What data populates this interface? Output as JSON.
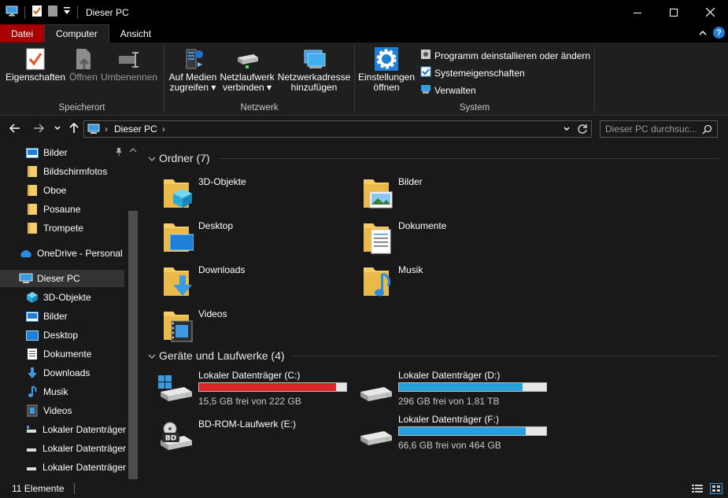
{
  "window": {
    "title": "Dieser PC",
    "controls": {
      "minimize": "—",
      "maximize": "☐",
      "close": "✕"
    }
  },
  "ribbon_tabs": [
    {
      "label": "Datei"
    },
    {
      "label": "Computer"
    },
    {
      "label": "Ansicht"
    }
  ],
  "ribbon": {
    "groups": {
      "speicherort": "Speicherort",
      "netzwerk": "Netzwerk",
      "system": "System"
    },
    "eigenschaften": "Eigenschaften",
    "oeffnen": "Öffnen",
    "umbenennen": "Umbenennen",
    "auf_medien": [
      "Auf Medien",
      "zugreifen ▾"
    ],
    "netzlaufwerk": [
      "Netzlaufwerk",
      "verbinden ▾"
    ],
    "netzwerkadresse": [
      "Netzwerkadresse",
      "hinzufügen"
    ],
    "einstellungen": [
      "Einstellungen",
      "öffnen"
    ],
    "programm_deinstallieren": "Programm deinstallieren oder ändern",
    "systemeigenschaften": "Systemeigenschaften",
    "verwalten": "Verwalten"
  },
  "address": {
    "path": "Dieser PC",
    "separator": "›",
    "search_placeholder": "Dieser PC durchsuc..."
  },
  "nav": [
    {
      "label": "Bilder",
      "icon": "pictures-icon",
      "pinned": true
    },
    {
      "label": "Bildschirmfotos",
      "icon": "folder-icon"
    },
    {
      "label": "Oboe",
      "icon": "folder-icon"
    },
    {
      "label": "Posaune",
      "icon": "folder-icon"
    },
    {
      "label": "Trompete",
      "icon": "folder-icon"
    },
    {
      "label": "OneDrive - Personal",
      "icon": "onedrive-icon"
    },
    {
      "label": "Dieser PC",
      "icon": "pc-icon",
      "selected": true
    },
    {
      "label": "3D-Objekte",
      "icon": "cube-icon"
    },
    {
      "label": "Bilder",
      "icon": "pictures-icon"
    },
    {
      "label": "Desktop",
      "icon": "desktop-icon"
    },
    {
      "label": "Dokumente",
      "icon": "documents-icon"
    },
    {
      "label": "Downloads",
      "icon": "downloads-icon"
    },
    {
      "label": "Musik",
      "icon": "music-icon"
    },
    {
      "label": "Videos",
      "icon": "videos-icon"
    },
    {
      "label": "Lokaler Datenträger",
      "icon": "drive-icon"
    },
    {
      "label": "Lokaler Datenträger",
      "icon": "drive-icon"
    },
    {
      "label": "Lokaler Datenträger",
      "icon": "drive-icon"
    }
  ],
  "folders_header": "Ordner (7)",
  "folders": [
    {
      "label": "3D-Objekte",
      "icon": "cube-icon"
    },
    {
      "label": "Bilder",
      "icon": "pictures-icon"
    },
    {
      "label": "Desktop",
      "icon": "desktop-icon"
    },
    {
      "label": "Dokumente",
      "icon": "documents-icon"
    },
    {
      "label": "Downloads",
      "icon": "downloads-icon"
    },
    {
      "label": "Musik",
      "icon": "music-icon"
    },
    {
      "label": "Videos",
      "icon": "videos-icon"
    }
  ],
  "drives_header": "Geräte und Laufwerke (4)",
  "drives": [
    {
      "name": "Lokaler Datenträger (C:)",
      "free": "15,5 GB frei von 222 GB",
      "used_fraction": 0.93,
      "bar_color": "#da2626",
      "icon": "windows-drive-icon"
    },
    {
      "name": "Lokaler Datenträger (D:)",
      "free": "296 GB frei von 1,81 TB",
      "used_fraction": 0.84,
      "bar_color": "#26a0da",
      "icon": "drive-icon"
    },
    {
      "name": "BD-ROM-Laufwerk (E:)",
      "free": "",
      "used_fraction": null,
      "bar_color": null,
      "icon": "bd-rom-icon",
      "badge": "BD"
    },
    {
      "name": "Lokaler Datenträger (F:)",
      "free": "66,6 GB frei von 464 GB",
      "used_fraction": 0.86,
      "bar_color": "#26a0da",
      "icon": "drive-icon"
    }
  ],
  "status": {
    "count": "11 Elemente"
  }
}
